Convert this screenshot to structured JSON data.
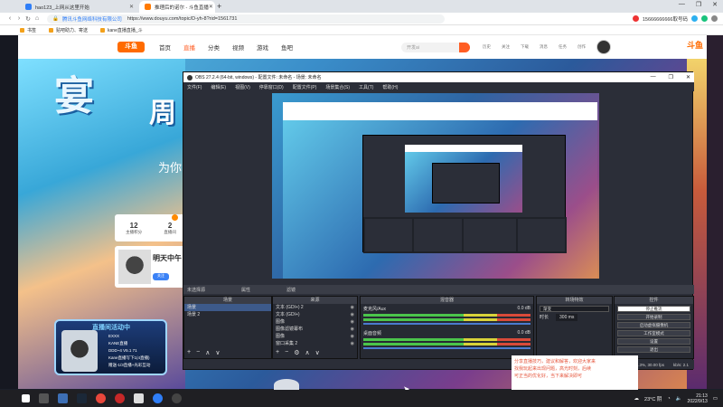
{
  "browser": {
    "tabs": [
      {
        "title": "hao123_上网从这里开始",
        "active": false
      },
      {
        "title": "推理后的诺尔 - 斗鱼直播",
        "active": true
      }
    ],
    "new_tab": "+",
    "window_controls": [
      "—",
      "❐",
      "✕"
    ],
    "url": "https://www.douyu.com/topic/D-yh-8?rid=1561731",
    "site_label": "腾讯斗鱼网络科技有限公司",
    "phone": "15666666666取号码",
    "bookmarks": [
      "书签",
      "贴吧助力、寄送",
      "kane直播直播_斗"
    ]
  },
  "douyu": {
    "logo": "斗鱼",
    "nav": [
      "首页",
      "直播",
      "分类",
      "视频",
      "游戏",
      "鱼吧"
    ],
    "active_nav": "直播",
    "search_placeholder": "开发ai",
    "icons": [
      "历史",
      "关注",
      "下载",
      "消息",
      "任务",
      "创作"
    ],
    "brand": "斗鱼"
  },
  "stream": {
    "hero_title": "宴",
    "hero_sub": "周",
    "hero_tag": "为你",
    "card": {
      "follows": "12",
      "follows_label": "主播积分",
      "fans_label": "直播间",
      "fans": "2"
    },
    "host": {
      "name": "明天中午",
      "follow_label": "关注"
    }
  },
  "obs": {
    "title": "OBS 27.2.4 (64-bit, windows) - 配置文件: 未命名 - 场景: 未命名",
    "menu": [
      "文件(F)",
      "编辑(E)",
      "视图(V)",
      "停靠窗口(D)",
      "配置文件(P)",
      "场景集合(S)",
      "工具(T)",
      "帮助(H)"
    ],
    "scene_bar": [
      "未选择源",
      "属性",
      "滤镜"
    ],
    "docks": {
      "scenes": {
        "title": "场景",
        "items": [
          "场景",
          "场景 2"
        ]
      },
      "sources": {
        "title": "来源",
        "items": [
          "文本 (GDI+) 2",
          "文本 (GDI+)",
          "图像",
          "图像滤镜幕布",
          "图像",
          "窗口采集 2"
        ]
      },
      "mixer": {
        "title": "混音器",
        "rows": [
          {
            "name": "麦克风/Aux",
            "db": "0.0 dB"
          },
          {
            "name": "桌面音频",
            "db": "0.0 dB"
          }
        ]
      },
      "transitions": {
        "title": "转场特效",
        "select": "渐变",
        "duration_label": "时长",
        "duration": "300 ms"
      },
      "controls": {
        "title": "控件",
        "buttons": [
          "停止推流",
          "开始录制",
          "启动虚拟摄像机",
          "工作室模式",
          "设置",
          "退出"
        ]
      }
    },
    "status": [
      "LIVE: 00:00:00",
      "REC: 00:00:00",
      "CPU: 1.3%, 30.00 fps",
      "kb/s: 2.1"
    ],
    "footer_icons": [
      "+",
      "−",
      "⚙",
      "∧",
      "∨"
    ]
  },
  "overlay": {
    "banner_title": "直播间活动中",
    "banner_lines": [
      "EXXX",
      "KANE直播",
      "DDD~4 V5.1 71",
      "Kane直播写下1(4直播)",
      "赠送-1/3直播+光彩互动"
    ],
    "comment": [
      "分享直播技巧，建议和解答，欢迎大家来",
      "找我玩起来出现问题，高光时刻，后续",
      "可正当的优化好，当下来解决即可"
    ]
  },
  "taskbar": {
    "weather": "23°C 阴",
    "time": "21:13",
    "date": "2022/9/13"
  },
  "colors": {
    "accent": "#ff5d23",
    "obs_bg": "#2b2e38"
  }
}
